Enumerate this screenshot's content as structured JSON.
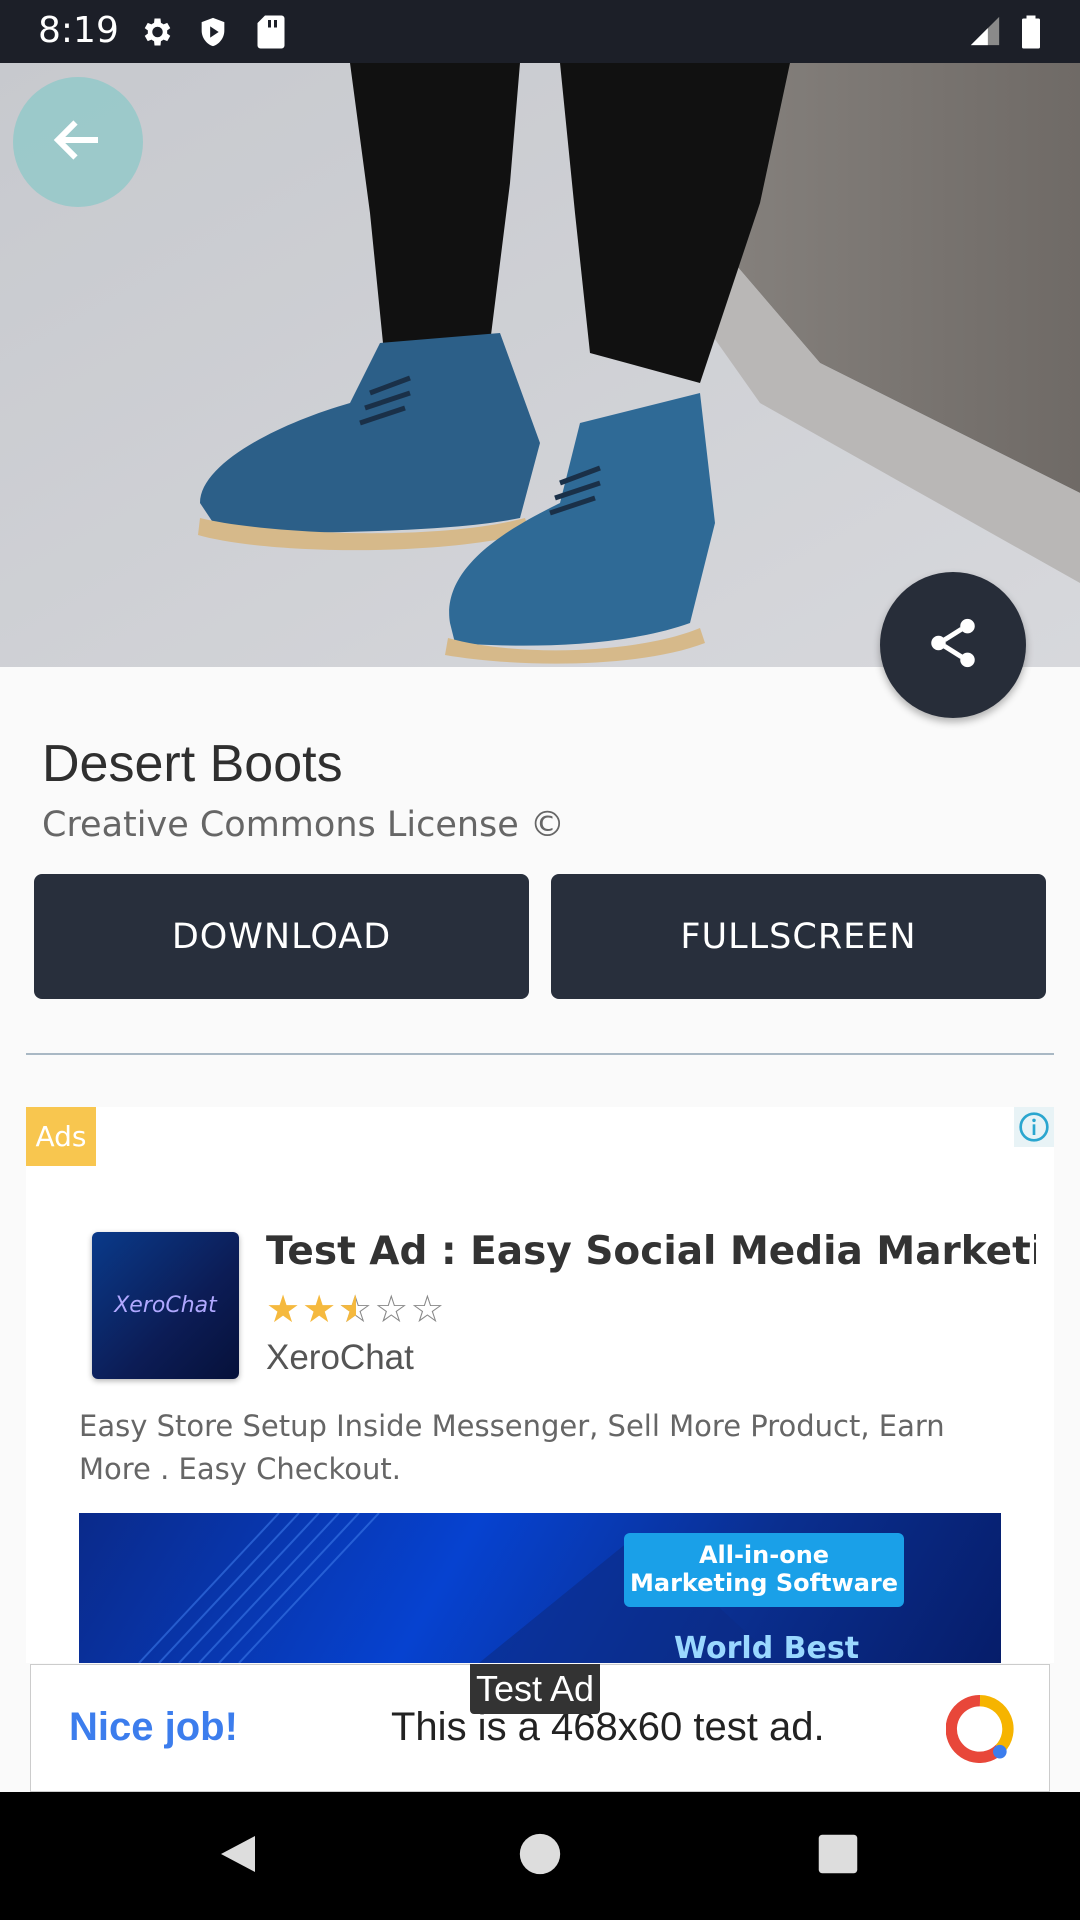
{
  "status": {
    "time": "8:19"
  },
  "item": {
    "title": "Desert Boots",
    "license": "Creative Commons License ©"
  },
  "actions": {
    "download": "DOWNLOAD",
    "fullscreen": "FULLSCREEN"
  },
  "ad": {
    "badge": "Ads",
    "logo_text": "XeroChat",
    "headline": "Test Ad : Easy Social Media Marketi",
    "rating": 2.5,
    "rating_max": 5,
    "advertiser": "XeroChat",
    "body": "Easy Store Setup Inside Messenger, Sell More Product, Earn More . Easy Checkout.",
    "banner_line1": "All-in-one",
    "banner_line2": "Marketing Software",
    "banner_line3": "World Best"
  },
  "bottom_ad": {
    "label": "Test Ad",
    "nice_job": "Nice job!",
    "text": "This is a 468x60 test ad."
  },
  "colors": {
    "accent_dark": "#282f3c",
    "ads_badge": "#f8c64f",
    "star": "#f5b93e"
  }
}
